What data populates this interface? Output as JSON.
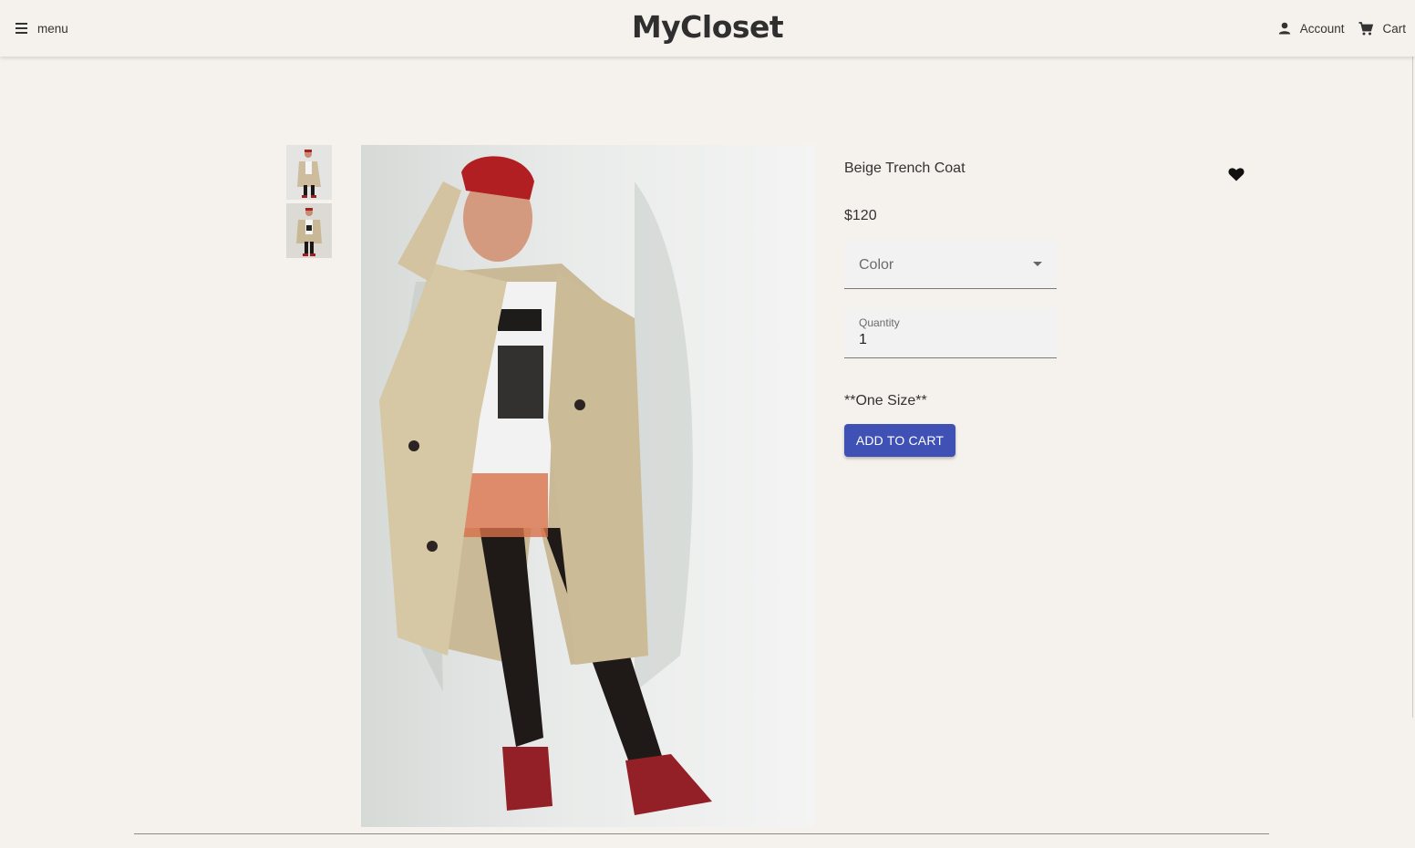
{
  "header": {
    "menu_label": "menu",
    "logo": "MyCloset",
    "account_label": "Account",
    "cart_label": "Cart"
  },
  "product": {
    "title": "Beige Trench Coat",
    "price": "$120",
    "color_label": "Color",
    "quantity_label": "Quantity",
    "quantity_value": "1",
    "size_note": "**One Size**",
    "add_to_cart_label": "ADD TO CART"
  },
  "icons": {
    "menu": "menu-icon",
    "account": "person-icon",
    "cart": "shopping-cart-icon",
    "favorite": "heart-icon",
    "dropdown": "caret-down-icon"
  },
  "colors": {
    "background": "#f5f1ec",
    "primary_button": "#3f51b5",
    "field_background": "#f2f2f2"
  }
}
